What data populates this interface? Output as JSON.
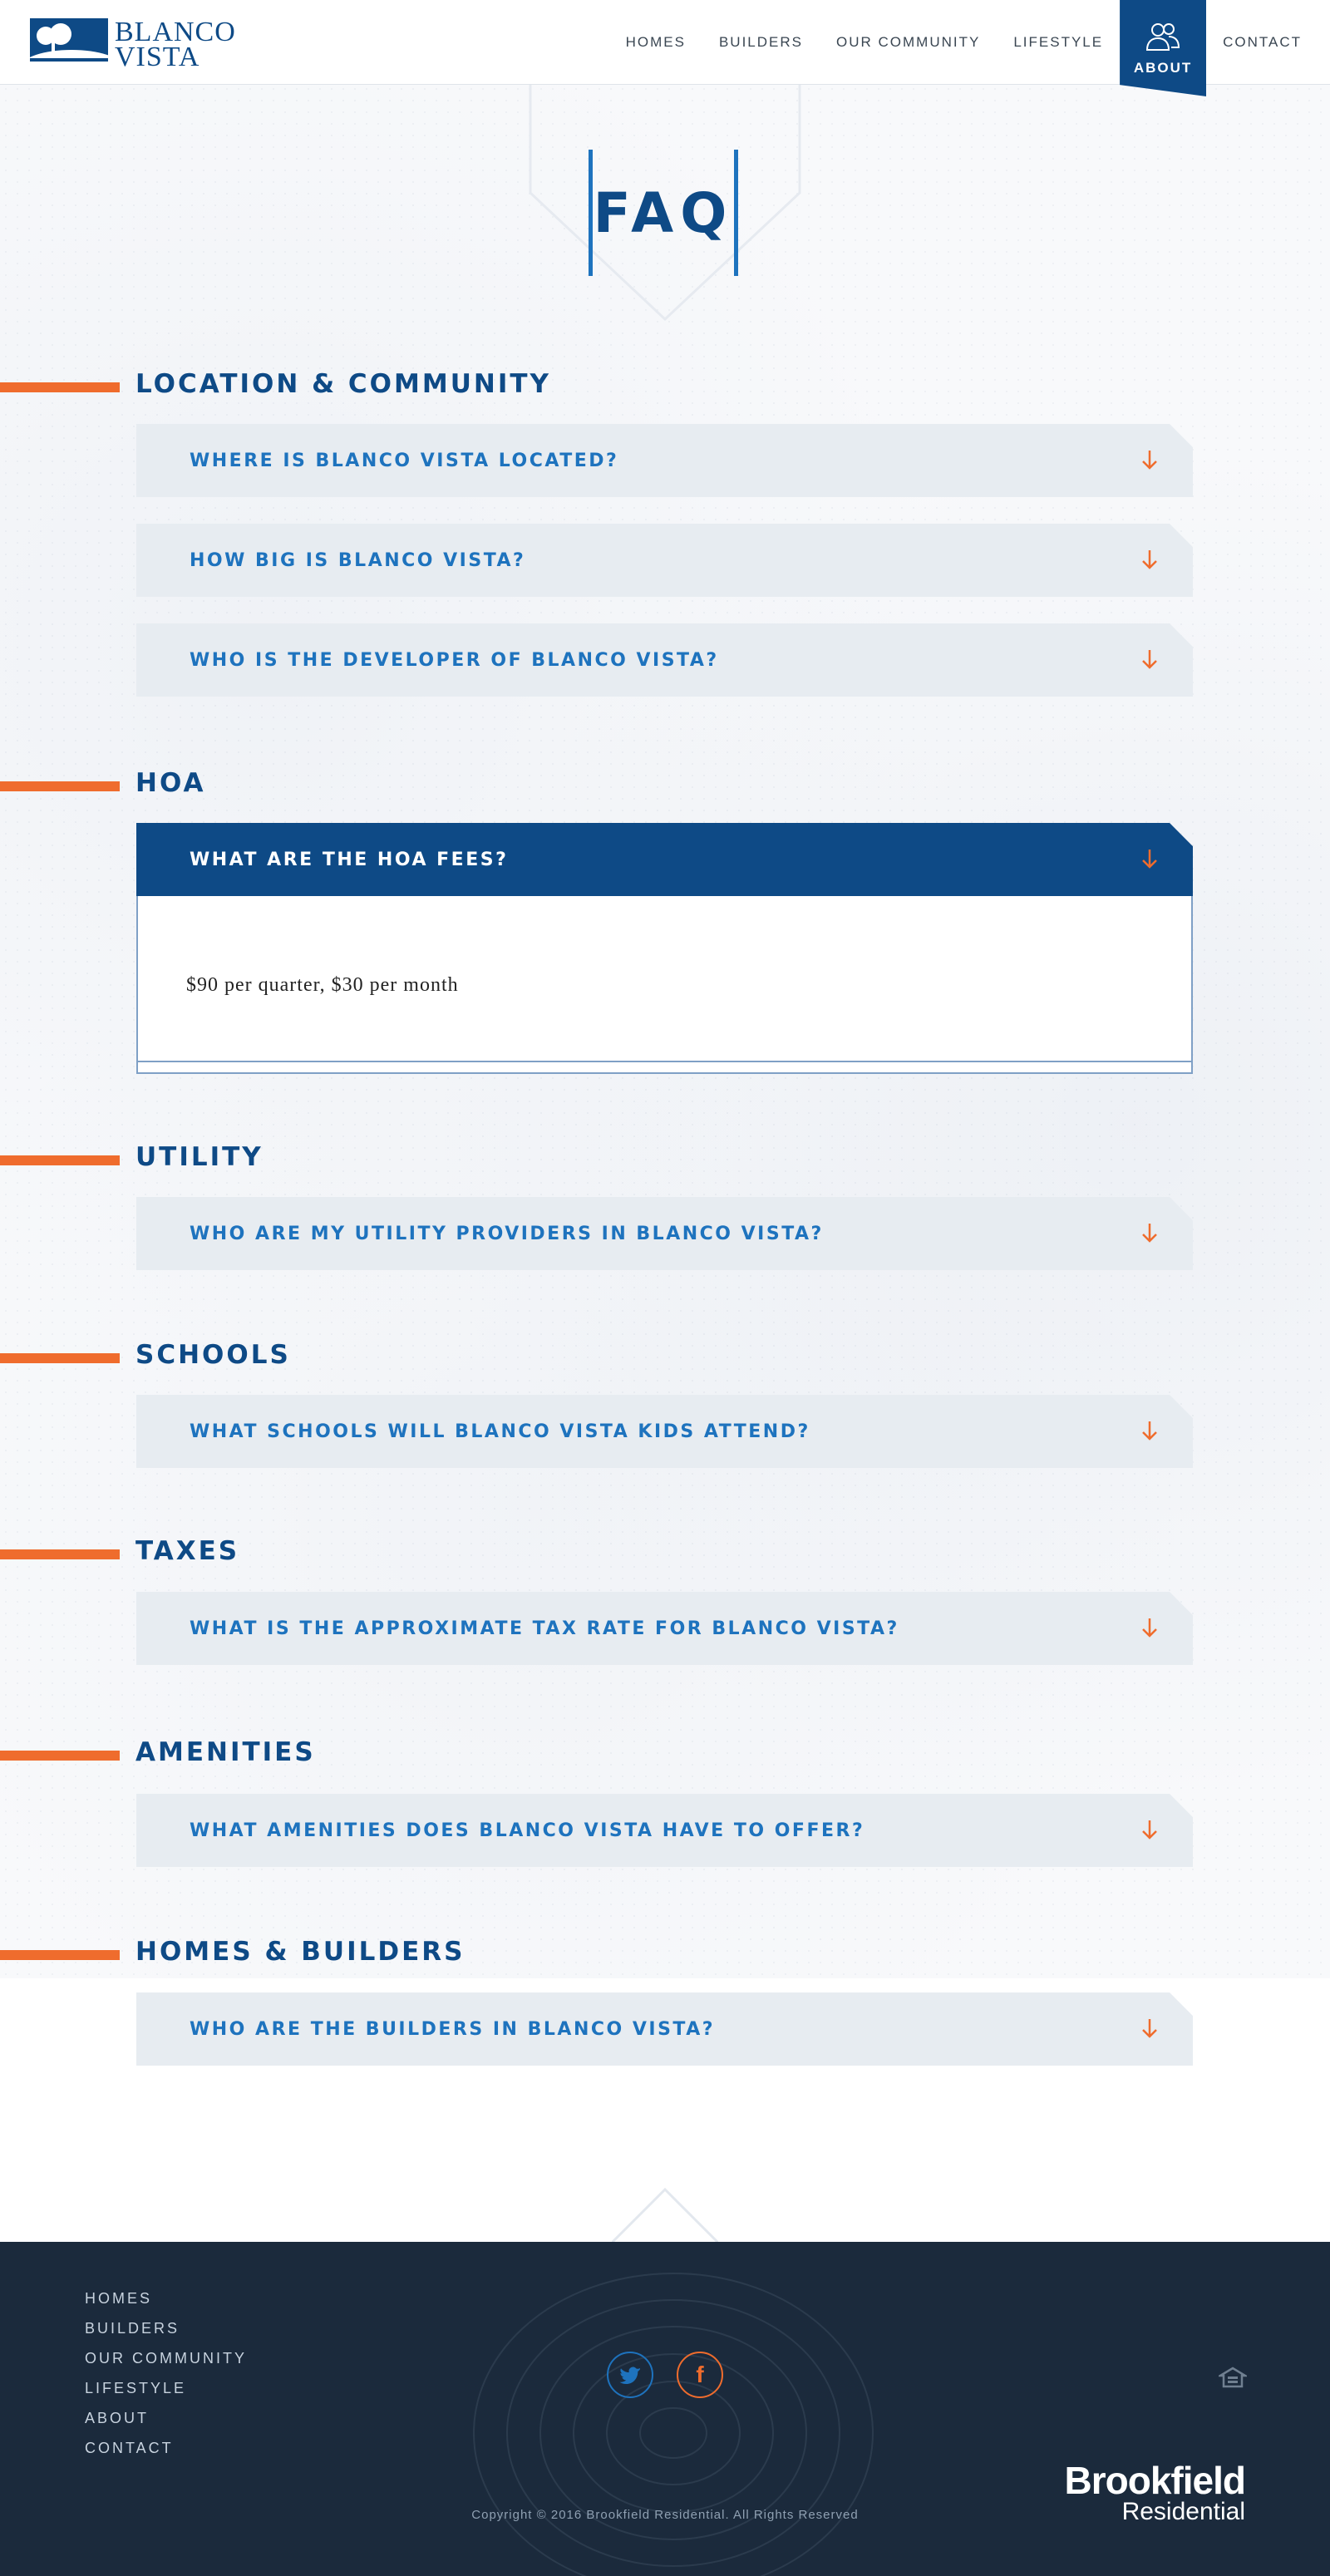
{
  "brand": {
    "logo_line1": "BLANCO",
    "logo_line2": "VISTA"
  },
  "nav": {
    "items": [
      "HOMES",
      "BUILDERS",
      "OUR COMMUNITY",
      "LIFESTYLE"
    ],
    "active": "ABOUT",
    "contact": "CONTACT"
  },
  "page": {
    "title": "FAQ"
  },
  "sections": [
    {
      "title": "LOCATION & COMMUNITY",
      "questions": [
        "WHERE IS BLANCO VISTA LOCATED?",
        "HOW BIG IS BLANCO VISTA?",
        "WHO IS THE DEVELOPER OF BLANCO VISTA?"
      ]
    },
    {
      "title": "HOA",
      "questions": [
        "WHAT ARE THE HOA FEES?"
      ],
      "open_answer": "$90 per quarter, $30 per month"
    },
    {
      "title": "UTILITY",
      "questions": [
        "WHO ARE MY UTILITY PROVIDERS IN BLANCO VISTA?"
      ]
    },
    {
      "title": "SCHOOLS",
      "questions": [
        "WHAT SCHOOLS WILL BLANCO VISTA KIDS ATTEND?"
      ]
    },
    {
      "title": "TAXES",
      "questions": [
        "WHAT IS THE APPROXIMATE TAX RATE FOR BLANCO VISTA?"
      ]
    },
    {
      "title": "AMENITIES",
      "questions": [
        "WHAT AMENITIES DOES BLANCO VISTA HAVE TO OFFER?"
      ]
    },
    {
      "title": "HOMES & BUILDERS",
      "questions": [
        "WHO ARE THE BUILDERS IN BLANCO VISTA?"
      ]
    }
  ],
  "footer": {
    "nav": [
      "HOMES",
      "BUILDERS",
      "OUR COMMUNITY",
      "LIFESTYLE",
      "ABOUT",
      "CONTACT"
    ],
    "social": {
      "twitter": "twitter-icon",
      "facebook": "facebook-icon"
    },
    "brand_line1": "Brookfield",
    "brand_line2": "Residential",
    "copyright": "Copyright © 2016 Brookfield Residential. All Rights Reserved"
  },
  "colors": {
    "primary": "#0e4a86",
    "accent_blue": "#1e73be",
    "accent_orange": "#ef6c2d",
    "row_bg": "#e7ecf1",
    "footer_bg": "#1b2a3c"
  }
}
